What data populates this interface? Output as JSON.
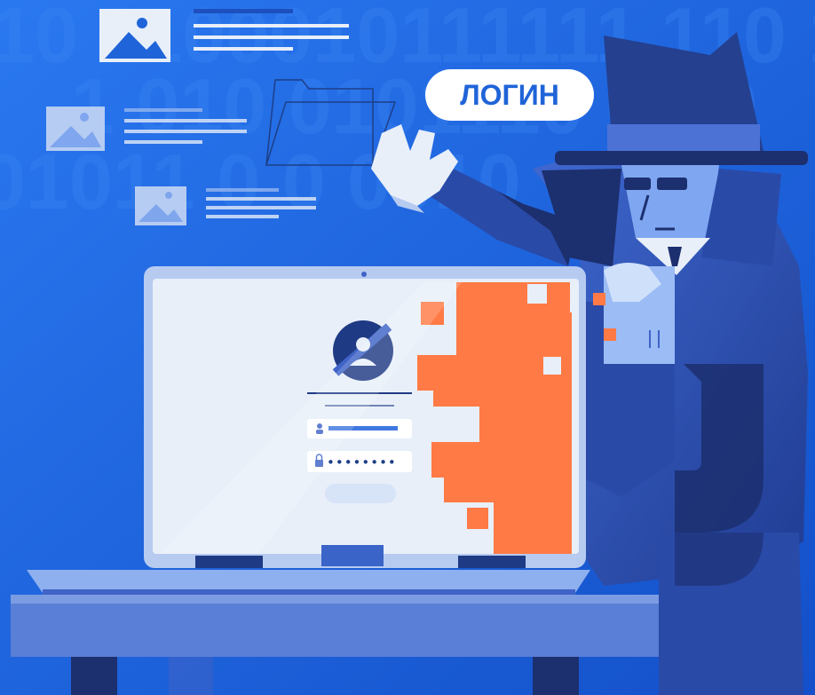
{
  "badge": {
    "label": "ЛОГИН"
  },
  "binary_rows": [
    "10 1100010111111 110 10",
    "1 010 0101110 0 10",
    "01011 0 0 0010"
  ],
  "password_mask": "••••••••",
  "colors": {
    "background": "#1f6ae0",
    "accent_orange": "#ff7a45",
    "spy_dark": "#1c2f6e",
    "spy_mid": "#3f63c7",
    "screen": "#e8eff9"
  },
  "icons": [
    "image-icon",
    "folder-icon",
    "user-avatar-icon",
    "user-icon",
    "lock-icon"
  ]
}
